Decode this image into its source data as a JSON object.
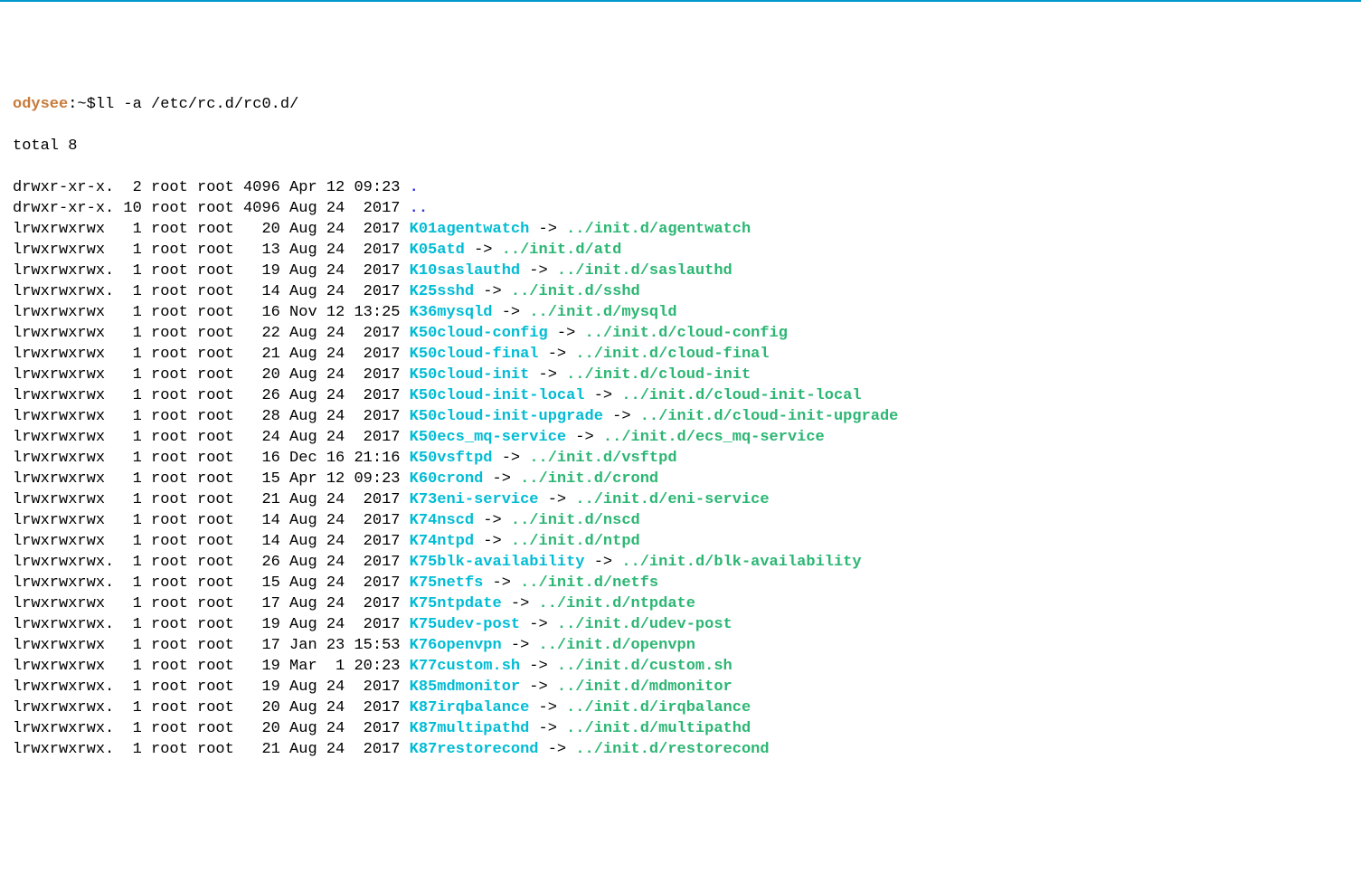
{
  "prompt": {
    "host": "odysee",
    "sep": ":~$",
    "command": "ll -a /etc/rc.d/rc0.d/"
  },
  "total_line": "total 8",
  "entries": [
    {
      "perm": "drwxr-xr-x.",
      "nl": " 2",
      "own": "root",
      "grp": "root",
      "size": "4096",
      "date": "Apr 12 09:23",
      "name": ".",
      "type": "dir"
    },
    {
      "perm": "drwxr-xr-x.",
      "nl": "10",
      "own": "root",
      "grp": "root",
      "size": "4096",
      "date": "Aug 24  2017",
      "name": "..",
      "type": "dir"
    },
    {
      "perm": "lrwxrwxrwx ",
      "nl": " 1",
      "own": "root",
      "grp": "root",
      "size": "  20",
      "date": "Aug 24  2017",
      "name": "K01agentwatch",
      "target": "../init.d/agentwatch",
      "type": "sym"
    },
    {
      "perm": "lrwxrwxrwx ",
      "nl": " 1",
      "own": "root",
      "grp": "root",
      "size": "  13",
      "date": "Aug 24  2017",
      "name": "K05atd",
      "target": "../init.d/atd",
      "type": "sym"
    },
    {
      "perm": "lrwxrwxrwx.",
      "nl": " 1",
      "own": "root",
      "grp": "root",
      "size": "  19",
      "date": "Aug 24  2017",
      "name": "K10saslauthd",
      "target": "../init.d/saslauthd",
      "type": "sym"
    },
    {
      "perm": "lrwxrwxrwx.",
      "nl": " 1",
      "own": "root",
      "grp": "root",
      "size": "  14",
      "date": "Aug 24  2017",
      "name": "K25sshd",
      "target": "../init.d/sshd",
      "type": "sym"
    },
    {
      "perm": "lrwxrwxrwx ",
      "nl": " 1",
      "own": "root",
      "grp": "root",
      "size": "  16",
      "date": "Nov 12 13:25",
      "name": "K36mysqld",
      "target": "../init.d/mysqld",
      "type": "sym"
    },
    {
      "perm": "lrwxrwxrwx ",
      "nl": " 1",
      "own": "root",
      "grp": "root",
      "size": "  22",
      "date": "Aug 24  2017",
      "name": "K50cloud-config",
      "target": "../init.d/cloud-config",
      "type": "sym"
    },
    {
      "perm": "lrwxrwxrwx ",
      "nl": " 1",
      "own": "root",
      "grp": "root",
      "size": "  21",
      "date": "Aug 24  2017",
      "name": "K50cloud-final",
      "target": "../init.d/cloud-final",
      "type": "sym"
    },
    {
      "perm": "lrwxrwxrwx ",
      "nl": " 1",
      "own": "root",
      "grp": "root",
      "size": "  20",
      "date": "Aug 24  2017",
      "name": "K50cloud-init",
      "target": "../init.d/cloud-init",
      "type": "sym"
    },
    {
      "perm": "lrwxrwxrwx ",
      "nl": " 1",
      "own": "root",
      "grp": "root",
      "size": "  26",
      "date": "Aug 24  2017",
      "name": "K50cloud-init-local",
      "target": "../init.d/cloud-init-local",
      "type": "sym"
    },
    {
      "perm": "lrwxrwxrwx ",
      "nl": " 1",
      "own": "root",
      "grp": "root",
      "size": "  28",
      "date": "Aug 24  2017",
      "name": "K50cloud-init-upgrade",
      "target": "../init.d/cloud-init-upgrade",
      "type": "sym"
    },
    {
      "perm": "lrwxrwxrwx ",
      "nl": " 1",
      "own": "root",
      "grp": "root",
      "size": "  24",
      "date": "Aug 24  2017",
      "name": "K50ecs_mq-service",
      "target": "../init.d/ecs_mq-service",
      "type": "sym"
    },
    {
      "perm": "lrwxrwxrwx ",
      "nl": " 1",
      "own": "root",
      "grp": "root",
      "size": "  16",
      "date": "Dec 16 21:16",
      "name": "K50vsftpd",
      "target": "../init.d/vsftpd",
      "type": "sym"
    },
    {
      "perm": "lrwxrwxrwx ",
      "nl": " 1",
      "own": "root",
      "grp": "root",
      "size": "  15",
      "date": "Apr 12 09:23",
      "name": "K60crond",
      "target": "../init.d/crond",
      "type": "sym"
    },
    {
      "perm": "lrwxrwxrwx ",
      "nl": " 1",
      "own": "root",
      "grp": "root",
      "size": "  21",
      "date": "Aug 24  2017",
      "name": "K73eni-service",
      "target": "../init.d/eni-service",
      "type": "sym"
    },
    {
      "perm": "lrwxrwxrwx ",
      "nl": " 1",
      "own": "root",
      "grp": "root",
      "size": "  14",
      "date": "Aug 24  2017",
      "name": "K74nscd",
      "target": "../init.d/nscd",
      "type": "sym"
    },
    {
      "perm": "lrwxrwxrwx ",
      "nl": " 1",
      "own": "root",
      "grp": "root",
      "size": "  14",
      "date": "Aug 24  2017",
      "name": "K74ntpd",
      "target": "../init.d/ntpd",
      "type": "sym"
    },
    {
      "perm": "lrwxrwxrwx.",
      "nl": " 1",
      "own": "root",
      "grp": "root",
      "size": "  26",
      "date": "Aug 24  2017",
      "name": "K75blk-availability",
      "target": "../init.d/blk-availability",
      "type": "sym"
    },
    {
      "perm": "lrwxrwxrwx.",
      "nl": " 1",
      "own": "root",
      "grp": "root",
      "size": "  15",
      "date": "Aug 24  2017",
      "name": "K75netfs",
      "target": "../init.d/netfs",
      "type": "sym"
    },
    {
      "perm": "lrwxrwxrwx ",
      "nl": " 1",
      "own": "root",
      "grp": "root",
      "size": "  17",
      "date": "Aug 24  2017",
      "name": "K75ntpdate",
      "target": "../init.d/ntpdate",
      "type": "sym"
    },
    {
      "perm": "lrwxrwxrwx.",
      "nl": " 1",
      "own": "root",
      "grp": "root",
      "size": "  19",
      "date": "Aug 24  2017",
      "name": "K75udev-post",
      "target": "../init.d/udev-post",
      "type": "sym"
    },
    {
      "perm": "lrwxrwxrwx ",
      "nl": " 1",
      "own": "root",
      "grp": "root",
      "size": "  17",
      "date": "Jan 23 15:53",
      "name": "K76openvpn",
      "target": "../init.d/openvpn",
      "type": "sym"
    },
    {
      "perm": "lrwxrwxrwx ",
      "nl": " 1",
      "own": "root",
      "grp": "root",
      "size": "  19",
      "date": "Mar  1 20:23",
      "name": "K77custom.sh",
      "target": "../init.d/custom.sh",
      "type": "sym"
    },
    {
      "perm": "lrwxrwxrwx.",
      "nl": " 1",
      "own": "root",
      "grp": "root",
      "size": "  19",
      "date": "Aug 24  2017",
      "name": "K85mdmonitor",
      "target": "../init.d/mdmonitor",
      "type": "sym"
    },
    {
      "perm": "lrwxrwxrwx.",
      "nl": " 1",
      "own": "root",
      "grp": "root",
      "size": "  20",
      "date": "Aug 24  2017",
      "name": "K87irqbalance",
      "target": "../init.d/irqbalance",
      "type": "sym"
    },
    {
      "perm": "lrwxrwxrwx.",
      "nl": " 1",
      "own": "root",
      "grp": "root",
      "size": "  20",
      "date": "Aug 24  2017",
      "name": "K87multipathd",
      "target": "../init.d/multipathd",
      "type": "sym"
    },
    {
      "perm": "lrwxrwxrwx.",
      "nl": " 1",
      "own": "root",
      "grp": "root",
      "size": "  21",
      "date": "Aug 24  2017",
      "name": "K87restorecond",
      "target": "../init.d/restorecond",
      "type": "sym"
    }
  ]
}
